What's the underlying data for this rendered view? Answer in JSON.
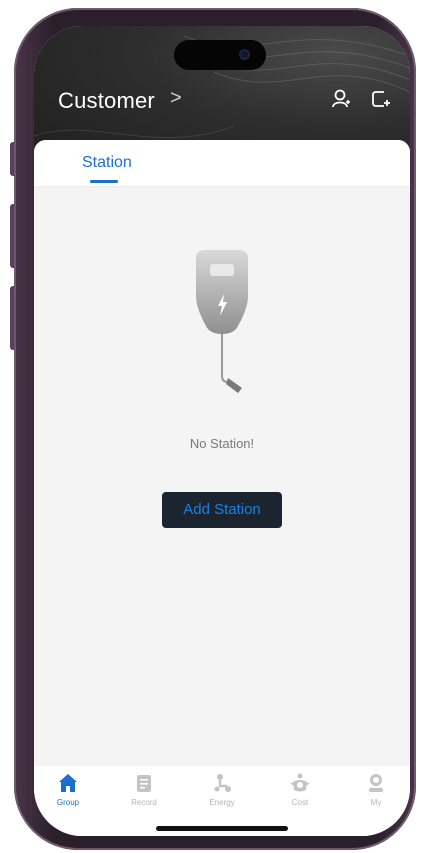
{
  "header": {
    "title": "Customer",
    "chevron": ">",
    "icons": [
      "person-icon",
      "add-device-icon"
    ]
  },
  "tabs": [
    {
      "label": "Station",
      "active": true
    }
  ],
  "empty_state": {
    "icon": "charger-icon",
    "message": "No Station!",
    "button_label": "Add Station"
  },
  "bottom_nav": [
    {
      "label": "Group",
      "icon": "home-icon",
      "active": true
    },
    {
      "label": "Record",
      "icon": "record-icon",
      "active": false
    },
    {
      "label": "Energy",
      "icon": "energy-icon",
      "active": false
    },
    {
      "label": "Cost",
      "icon": "cost-icon",
      "active": false
    },
    {
      "label": "My",
      "icon": "profile-icon",
      "active": false
    }
  ],
  "colors": {
    "accent": "#1a6fd1",
    "header_bg": "#2e2e2e",
    "button_bg": "#1c2430",
    "muted": "#b5b5b5"
  }
}
